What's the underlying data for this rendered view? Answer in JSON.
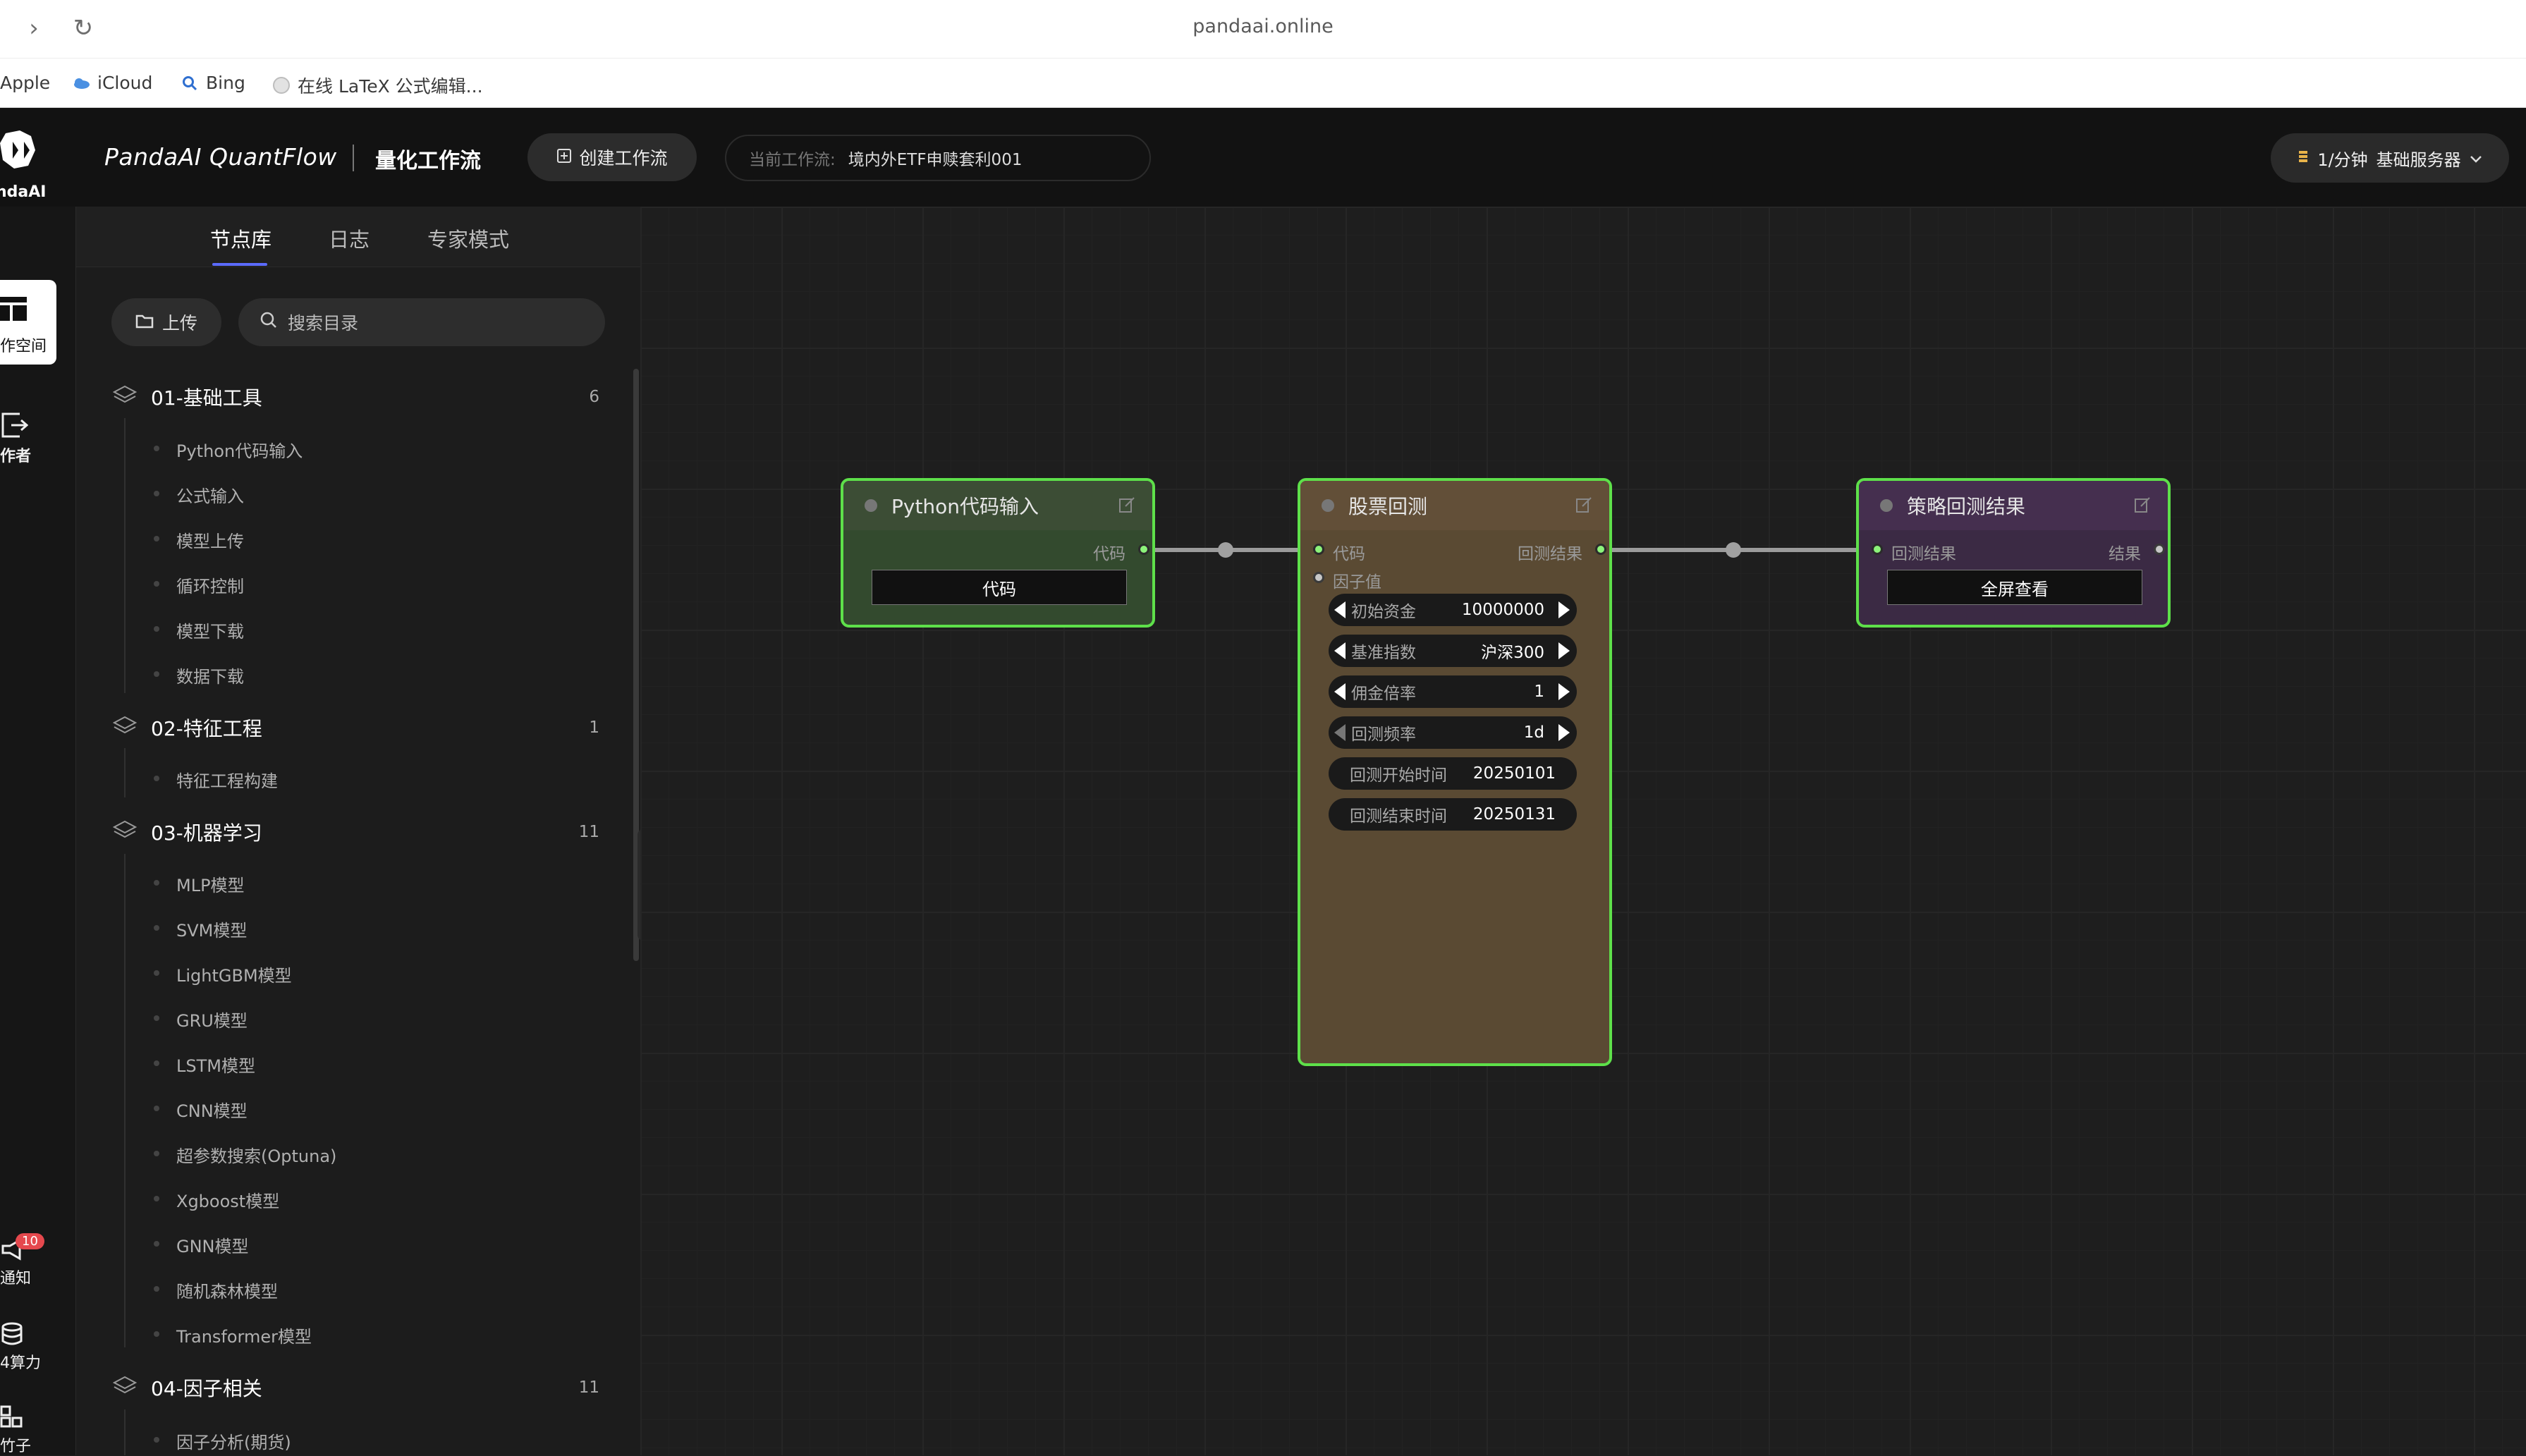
{
  "browser": {
    "url": "pandaai.online",
    "forward_glyph": "›",
    "reload_glyph": "↻"
  },
  "bookmarks": [
    {
      "label": "Apple",
      "icon": ""
    },
    {
      "label": "iCloud",
      "icon": "cloud-icon"
    },
    {
      "label": "Bing",
      "icon": "search-icon"
    },
    {
      "label": "在线 LaTeX 公式编辑...",
      "icon": "globe-icon"
    }
  ],
  "header": {
    "logo_text": "ndaAI",
    "brand": "PandaAI QuantFlow",
    "subtitle": "量化工作流",
    "create_button": "创建工作流",
    "current_label": "当前工作流:",
    "current_value": "境内外ETF申赎套利001",
    "server_rate": "1/分钟",
    "server_name": "基础服务器"
  },
  "rail": {
    "workspace": "作空间",
    "author": "作者",
    "notify": "通知",
    "notify_badge": "10",
    "compute": "4算力",
    "factor": "竹子"
  },
  "panel": {
    "tabs": [
      "节点库",
      "日志",
      "专家模式"
    ],
    "active_tab": 0,
    "upload": "上传",
    "search_placeholder": "搜索目录",
    "categories": [
      {
        "title": "01-基础工具",
        "count": "6",
        "items": [
          "Python代码输入",
          "公式输入",
          "模型上传",
          "循环控制",
          "模型下载",
          "数据下载"
        ]
      },
      {
        "title": "02-特征工程",
        "count": "1",
        "items": [
          "特征工程构建"
        ]
      },
      {
        "title": "03-机器学习",
        "count": "11",
        "items": [
          "MLP模型",
          "SVM模型",
          "LightGBM模型",
          "GRU模型",
          "LSTM模型",
          "CNN模型",
          "超参数搜索(Optuna)",
          "Xgboost模型",
          "GNN模型",
          "随机森林模型",
          "Transformer模型"
        ]
      },
      {
        "title": "04-因子相关",
        "count": "11",
        "items": [
          "因子分析(期货)"
        ]
      }
    ]
  },
  "nodes": {
    "python": {
      "title": "Python代码输入",
      "out_label": "代码",
      "button": "代码",
      "color": "#3a4a32"
    },
    "backtest": {
      "title": "股票回测",
      "in_code": "代码",
      "in_factor": "因子值",
      "out_label": "回测结果",
      "color": "#5c4b35",
      "widgets": [
        {
          "label": "初始资金",
          "value": "10000000",
          "arrows": true
        },
        {
          "label": "基准指数",
          "value": "沪深300",
          "arrows": true
        },
        {
          "label": "佣金倍率",
          "value": "1",
          "arrows": true
        },
        {
          "label": "回测频率",
          "value": "1d",
          "arrows": true
        },
        {
          "label": "回测开始时间",
          "value": "20250101",
          "arrows": false
        },
        {
          "label": "回测结束时间",
          "value": "20250131",
          "arrows": false
        }
      ]
    },
    "result": {
      "title": "策略回测结果",
      "in_label": "回测结果",
      "out_label": "结果",
      "button": "全屏查看",
      "color": "#3e2b45"
    }
  }
}
